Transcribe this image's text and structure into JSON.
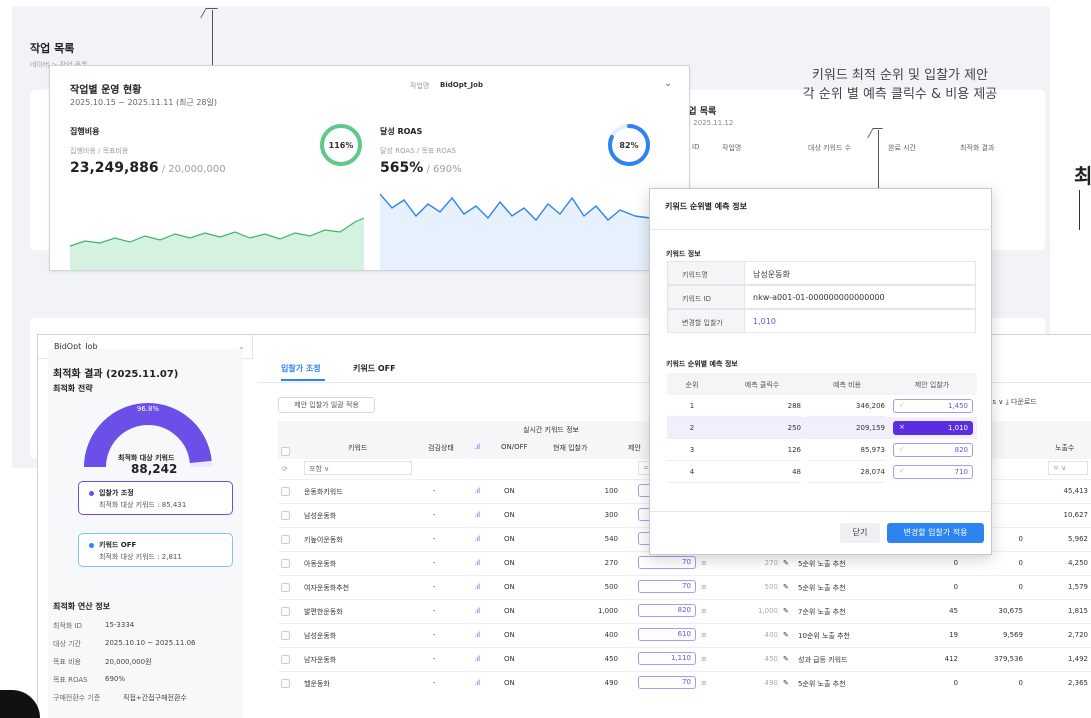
{
  "background": {
    "title": "작업 목록",
    "breadcrumb": "네이버 > 작업 목록",
    "work_list": {
      "title": "작업 목록",
      "date": "일 : 2025.11.12",
      "columns": [
        "ID",
        "작업명",
        "대상 키워드 수",
        "완료 시간",
        "최적화 결과"
      ]
    },
    "right_edge_glyph": "최"
  },
  "dashboard": {
    "title": "작업별 운영 현황",
    "period": "2025.10.15 ~ 2025.11.11 (최근 28일)",
    "job_label": "작업명",
    "job_name": "BidOpt_Job",
    "spend": {
      "title": "집행비용",
      "sub": "집행비용 / 목표비용",
      "value": "23,249,886",
      "target": " / 20,000,000",
      "ratio_label": "116%",
      "ratio": 1.16,
      "ring_color": "#5fc98a"
    },
    "roas": {
      "title": "달성 ROAS",
      "sub": "달성 ROAS / 목표 ROAS",
      "value": "565%",
      "target": " / 690%",
      "ratio_label": "82%",
      "ratio": 0.82,
      "ring_color": "#2d84f0"
    }
  },
  "annotation": {
    "line1": "키워드 최적 순위 및 입찰가 제안",
    "line2": "각 순위 별 예측 클릭수 & 비용 제공"
  },
  "optimization": {
    "job_select": "BidOpt_Job",
    "result_title": "최적화 결과 (2025.11.07)",
    "strategy_title": "최적화 전략",
    "gauge_pct_label": "96.8%",
    "gauge_pct": 0.968,
    "gauge_caption": "최적화 대상 키워드",
    "gauge_value": "88,242",
    "strategy_bid": {
      "title": "입찰가 조정",
      "desc": "최적화 대상 키워드 : 85,431"
    },
    "strategy_off": {
      "title": "키워드 OFF",
      "desc": "최적화 대상 키워드 : 2,811"
    },
    "calc_title": "최적화 연산 정보",
    "calc_rows": [
      {
        "k": "최적화 ID",
        "v": "15-3334"
      },
      {
        "k": "대상 기간",
        "v": "2025.10.10 ~ 2025.11.06"
      },
      {
        "k": "목표 비용",
        "v": "20,000,000원"
      },
      {
        "k": "목표 ROAS",
        "v": "690%"
      },
      {
        "k": "구매전환수 기준",
        "v": "직접+간접구매전환수"
      }
    ],
    "tabs": [
      "입찰가 조정",
      "키워드 OFF"
    ],
    "bulk_button": "제안 입찰가 일괄 적용",
    "toolbar_right": "ns ∨   ⤓ 다운로드",
    "table": {
      "group_header": "실시간 키워드 정보",
      "headers": {
        "keyword": "키워드",
        "status": "검김상태",
        "onoff": "ON/OFF",
        "bid": "현재 입찰가",
        "suggest": "제안",
        "impressions": "노출수"
      },
      "filter_placeholder": "포함 ∨",
      "rows": [
        {
          "kw": "운동화키워드",
          "st": "-",
          "on": "ON",
          "bid": "100",
          "sbid": "",
          "prev": "",
          "rec": "",
          "c1": "",
          "c2": "",
          "imp": "45,413"
        },
        {
          "kw": "남성운동화",
          "st": "-",
          "on": "ON",
          "bid": "300",
          "sbid": "",
          "prev": "",
          "rec": "",
          "c1": "",
          "c2": "",
          "imp": "10,627"
        },
        {
          "kw": "키높이운동화",
          "st": "-",
          "on": "ON",
          "bid": "540",
          "sbid": "70",
          "prev": "540",
          "rec": "4순위 노출 추천",
          "c1": "0",
          "c2": "0",
          "imp": "5,962"
        },
        {
          "kw": "아동운동화",
          "st": "-",
          "on": "ON",
          "bid": "270",
          "sbid": "70",
          "prev": "270",
          "rec": "5순위 노출 추천",
          "c1": "0",
          "c2": "0",
          "imp": "4,250"
        },
        {
          "kw": "여자운동화추천",
          "st": "-",
          "on": "ON",
          "bid": "500",
          "sbid": "70",
          "prev": "500",
          "rec": "5순위 노출 추천",
          "c1": "0",
          "c2": "0",
          "imp": "1,579"
        },
        {
          "kw": "발편한운동화",
          "st": "-",
          "on": "ON",
          "bid": "1,000",
          "sbid": "820",
          "prev": "1,000",
          "rec": "7순위 노출 추천",
          "c1": "45",
          "c2": "30,675",
          "imp": "1,815"
        },
        {
          "kw": "남성운동화",
          "st": "-",
          "on": "ON",
          "bid": "400",
          "sbid": "610",
          "prev": "400",
          "rec": "10순위 노출 추천",
          "c1": "19",
          "c2": "9,569",
          "imp": "2,720"
        },
        {
          "kw": "남자운동화",
          "st": "-",
          "on": "ON",
          "bid": "450",
          "sbid": "1,110",
          "prev": "450",
          "rec": "성과 급등 키워드",
          "c1": "412",
          "c2": "379,536",
          "imp": "1,492"
        },
        {
          "kw": "헬운동화",
          "st": "-",
          "on": "ON",
          "bid": "490",
          "sbid": "70",
          "prev": "490",
          "rec": "5순위 노출 추천",
          "c1": "0",
          "c2": "0",
          "imp": "2,365"
        }
      ]
    }
  },
  "modal": {
    "title": "키워드 순위별 예측 정보",
    "info_title": "키워드 정보",
    "info": [
      {
        "k": "키워드명",
        "v": "남성운동화"
      },
      {
        "k": "키워드 ID",
        "v": "nkw-a001-01-000000000000000"
      },
      {
        "k": "변경할 입찰가",
        "v": "1,010"
      }
    ],
    "rank_title": "키워드 순위별 예측 정보",
    "rank_headers": [
      "순위",
      "예측 클릭수",
      "예측 비용",
      "제안 입찰가"
    ],
    "rank_rows": [
      {
        "rank": "1",
        "clicks": "288",
        "cost": "346,206",
        "bid": "1,450",
        "selected": false
      },
      {
        "rank": "2",
        "clicks": "250",
        "cost": "209,159",
        "bid": "1,010",
        "selected": true
      },
      {
        "rank": "3",
        "clicks": "126",
        "cost": "85,973",
        "bid": "820",
        "selected": false
      },
      {
        "rank": "4",
        "clicks": "48",
        "cost": "28,074",
        "bid": "710",
        "selected": false
      }
    ],
    "close_label": "닫기",
    "apply_label": "변경할 입찰가 적용"
  },
  "colors": {
    "accent": "#6b4fe8",
    "primary": "#2d84f0",
    "green": "#5fc98a"
  }
}
